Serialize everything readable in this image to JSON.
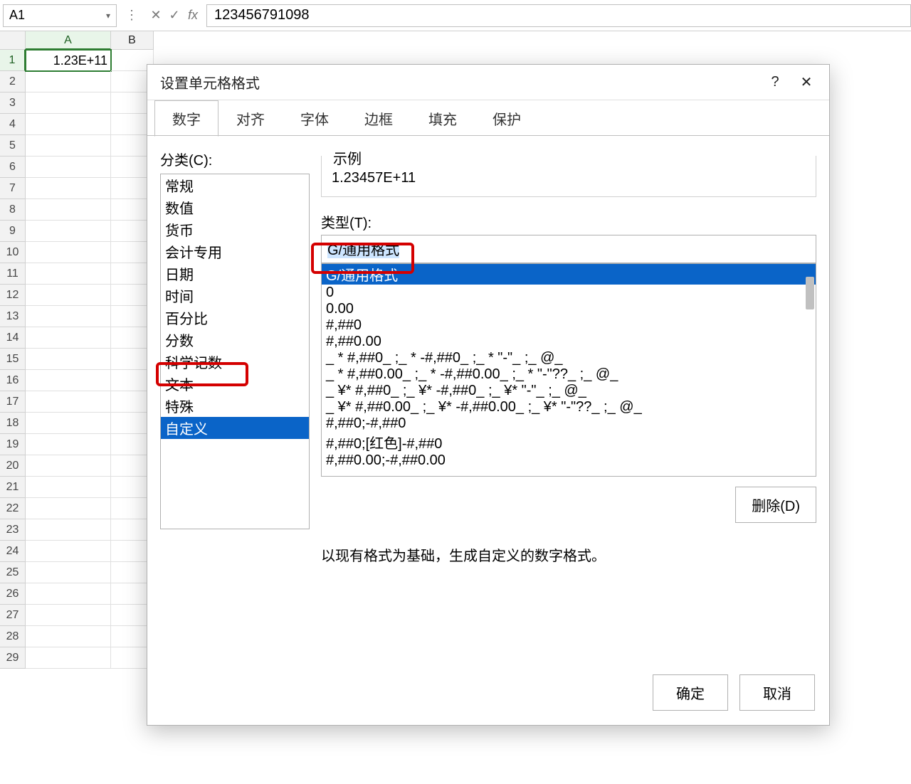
{
  "namebox": {
    "value": "A1"
  },
  "formula_bar": {
    "value": "123456791098"
  },
  "col_headers": [
    "A",
    "B"
  ],
  "row_headers": [
    1,
    2,
    3,
    4,
    5,
    6,
    7,
    8,
    9,
    10,
    11,
    12,
    13,
    14,
    15,
    16,
    17,
    18,
    19,
    20,
    21,
    22,
    23,
    24,
    25,
    26,
    27,
    28,
    29
  ],
  "cellA1": "1.23E+11",
  "dialog": {
    "title": "设置单元格格式",
    "help_icon": "?",
    "close_icon": "✕",
    "tabs": [
      "数字",
      "对齐",
      "字体",
      "边框",
      "填充",
      "保护"
    ],
    "active_tab": "数字",
    "category_label": "分类(C):",
    "categories": [
      "常规",
      "数值",
      "货币",
      "会计专用",
      "日期",
      "时间",
      "百分比",
      "分数",
      "科学记数",
      "文本",
      "特殊",
      "自定义"
    ],
    "selected_category": "自定义",
    "sample_label": "示例",
    "sample_value": "1.23457E+11",
    "type_label": "类型(T):",
    "type_value": "G/通用格式",
    "formats": [
      "G/通用格式",
      "0",
      "0.00",
      "#,##0",
      "#,##0.00",
      "_ * #,##0_ ;_ * -#,##0_ ;_ * \"-\"_ ;_ @_",
      "_ * #,##0.00_ ;_ * -#,##0.00_ ;_ * \"-\"??_ ;_ @_",
      "_ ¥* #,##0_ ;_ ¥* -#,##0_ ;_ ¥* \"-\"_ ;_ @_",
      "_ ¥* #,##0.00_ ;_ ¥* -#,##0.00_ ;_ ¥* \"-\"??_ ;_ @_",
      "#,##0;-#,##0",
      "#,##0;[红色]-#,##0",
      "#,##0.00;-#,##0.00"
    ],
    "selected_format": "G/通用格式",
    "delete_btn": "删除(D)",
    "hint": "以现有格式为基础，生成自定义的数字格式。",
    "ok": "确定",
    "cancel": "取消"
  }
}
